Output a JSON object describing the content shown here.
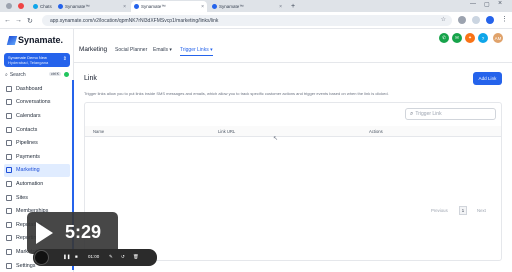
{
  "browser": {
    "tabs": [
      {
        "label": "Chats"
      },
      {
        "label": "Synamate™"
      },
      {
        "label": "Synamate™"
      },
      {
        "label": "Synamate™"
      }
    ],
    "url": "app.synamate.com/v2/location/qpmNK7rNl3dXFMSvcp1/marketing/links/link"
  },
  "sidebar": {
    "brand": "Synamate.",
    "account": {
      "name": "Synamate Demo New",
      "location": "Hyderabad, Telangana"
    },
    "search": {
      "label": "Search",
      "shortcut": "ctrl K"
    },
    "items": [
      {
        "label": "Dashboard"
      },
      {
        "label": "Conversations"
      },
      {
        "label": "Calendars"
      },
      {
        "label": "Contacts"
      },
      {
        "label": "Pipelines"
      },
      {
        "label": "Payments"
      },
      {
        "label": "Marketing"
      },
      {
        "label": "Automation"
      },
      {
        "label": "Sites"
      },
      {
        "label": "Memberships"
      },
      {
        "label": "Reputation"
      },
      {
        "label": "Reporting"
      },
      {
        "label": "Marketplace"
      },
      {
        "label": "Settings"
      }
    ]
  },
  "appbar": {
    "section": "Marketing",
    "nav": [
      {
        "label": "Social Planner"
      },
      {
        "label": "Emails ▾"
      },
      {
        "label": "Trigger Links ▾"
      }
    ],
    "avatar": "AM"
  },
  "main": {
    "title": "Link",
    "add_button": "Add Link",
    "description": "Trigger links allow you to put links inside SMS messages and emails, which allow you to track specific customer actions and trigger events based on when the link is clicked.",
    "search_placeholder": "Trigger Link",
    "columns": [
      "Name",
      "Link URL",
      "Actions"
    ],
    "pagination": {
      "previous": "Previous",
      "page": "1",
      "next": "Next"
    }
  },
  "video": {
    "time": "5:29",
    "controls_time": "01:00"
  },
  "colors": {
    "accent": "#2563eb",
    "sidebar_active_bg": "#e0ecff"
  }
}
